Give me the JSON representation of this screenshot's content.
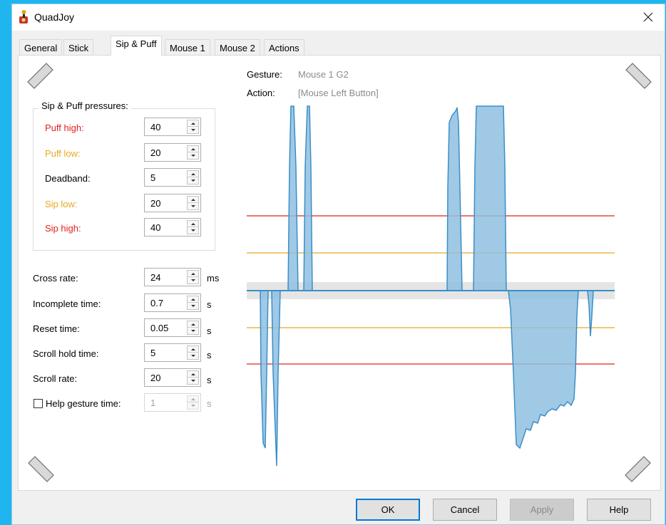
{
  "window": {
    "title": "QuadJoy"
  },
  "tabs": [
    {
      "label": "General"
    },
    {
      "label": "Stick"
    },
    {
      "label": "Sip & Puff"
    },
    {
      "label": "Mouse 1"
    },
    {
      "label": "Mouse 2"
    },
    {
      "label": "Actions"
    }
  ],
  "active_tab": "Sip & Puff",
  "pressures": {
    "group_title": "Sip & Puff pressures:",
    "puff_high": {
      "label": "Puff high:",
      "value": "40",
      "color": "#e32020"
    },
    "puff_low": {
      "label": "Puff low:",
      "value": "20",
      "color": "#e6a820"
    },
    "deadband": {
      "label": "Deadband:",
      "value": "5"
    },
    "sip_low": {
      "label": "Sip low:",
      "value": "20",
      "color": "#e6a820"
    },
    "sip_high": {
      "label": "Sip high:",
      "value": "40",
      "color": "#e32020"
    }
  },
  "timing": {
    "cross_rate": {
      "label": "Cross rate:",
      "value": "24",
      "unit": "ms"
    },
    "incomplete_time": {
      "label": "Incomplete time:",
      "value": "0.7",
      "unit": "s"
    },
    "reset_time": {
      "label": "Reset time:",
      "value": "0.05",
      "unit": "s"
    },
    "scroll_hold_time": {
      "label": "Scroll hold time:",
      "value": "5",
      "unit": "s"
    },
    "scroll_rate": {
      "label": "Scroll rate:",
      "value": "20",
      "unit": "s"
    },
    "help_gesture_time": {
      "label": "Help gesture time:",
      "value": "1",
      "unit": "s",
      "checked": false,
      "enabled": false
    }
  },
  "gesture_info": {
    "gesture_label": "Gesture:",
    "gesture_value": "Mouse 1 G2",
    "action_label": "Action:",
    "action_value": "[Mouse Left Button]"
  },
  "buttons": {
    "ok": "OK",
    "cancel": "Cancel",
    "apply": "Apply",
    "help": "Help"
  },
  "icons": {
    "app": "quadjoy-app-icon",
    "close": "close-icon",
    "corners": "rounded-corner-marker-icon"
  },
  "colors": {
    "desktop_bg": "#1fb6f0",
    "signal_fill": "#8fbfe0",
    "signal_stroke": "#3a8fc8",
    "high_threshold": "#e32020",
    "low_threshold": "#e6a820",
    "deadband_band": "#e5e5e5"
  }
}
